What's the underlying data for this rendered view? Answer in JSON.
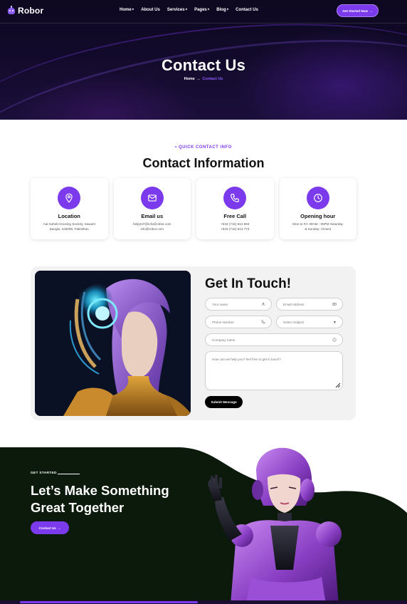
{
  "header": {
    "brand": "Robor",
    "nav": [
      {
        "label": "Home",
        "has_dropdown": true
      },
      {
        "label": "About Us",
        "has_dropdown": false
      },
      {
        "label": "Services",
        "has_dropdown": true
      },
      {
        "label": "Pages",
        "has_dropdown": true
      },
      {
        "label": "Blog",
        "has_dropdown": true
      },
      {
        "label": "Contact Us",
        "has_dropdown": false
      }
    ],
    "cta_label": "Get Started Now"
  },
  "hero": {
    "title": "Contact Us",
    "breadcrumb_home": "Home",
    "breadcrumb_current": "Contact Us"
  },
  "contact_info": {
    "eyebrow": "• QUICK CONTACT INFO",
    "title": "Contact Information",
    "cards": [
      {
        "icon": "location-pin-icon",
        "title": "Location",
        "line1": "Aai Saheb Housing Society, Sawant",
        "line2": "Bangla, 433008, Pakisthan"
      },
      {
        "icon": "envelope-icon",
        "title": "Email us",
        "line1": "help247@info@robor.com",
        "line2": "info@robor.com"
      },
      {
        "icon": "phone-icon",
        "title": "Free Call",
        "line1": "+919 (715) 513 663",
        "line2": "+919 (715) 513 773"
      },
      {
        "icon": "clock-icon",
        "title": "Opening hour",
        "line1": "Mon to Fri: 09AM - 05PM Saturday",
        "line2": "& Sunday: Closed"
      }
    ]
  },
  "form": {
    "title": "Get In Touch!",
    "name_placeholder": "Your name",
    "email_placeholder": "Email Address",
    "phone_placeholder": "Phone Number",
    "subject_value": "Select Subject",
    "company_placeholder": "Company name",
    "message_placeholder": "How can we help you? feel free to get in touch?",
    "submit_label": "Submit Message"
  },
  "cta_band": {
    "kicker": "GET STARTED",
    "headline_line1": "Let’s Make Something",
    "headline_line2": "Great Together",
    "button_label": "Contact Us"
  },
  "colors": {
    "accent": "#7c3aed",
    "hero_bg": "#120a2a",
    "band_bg": "#0b1a0b",
    "form_bg": "#f2f2f2"
  }
}
